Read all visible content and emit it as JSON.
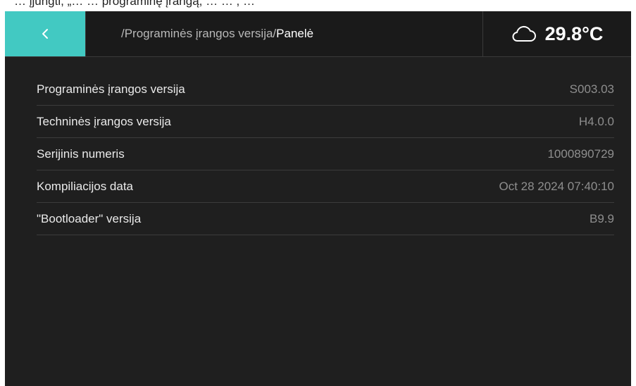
{
  "top_strip_text": "… įjungti, „… … programinę įrangą, … … , …",
  "header": {
    "breadcrumb_path": "/Programinės įrangos versija/",
    "breadcrumb_current": "Panelė",
    "weather_icon": "cloud-icon",
    "temperature": "29.8°C",
    "accent_color": "#42c9c2"
  },
  "info": [
    {
      "label": "Programinės įrangos versija",
      "value": "S003.03"
    },
    {
      "label": "Techninės įrangos versija",
      "value": "H4.0.0"
    },
    {
      "label": "Serijinis numeris",
      "value": "1000890729"
    },
    {
      "label": "Kompiliacijos data",
      "value": "Oct 28 2024 07:40:10"
    },
    {
      "label": "\"Bootloader\" versija",
      "value": "B9.9"
    }
  ]
}
